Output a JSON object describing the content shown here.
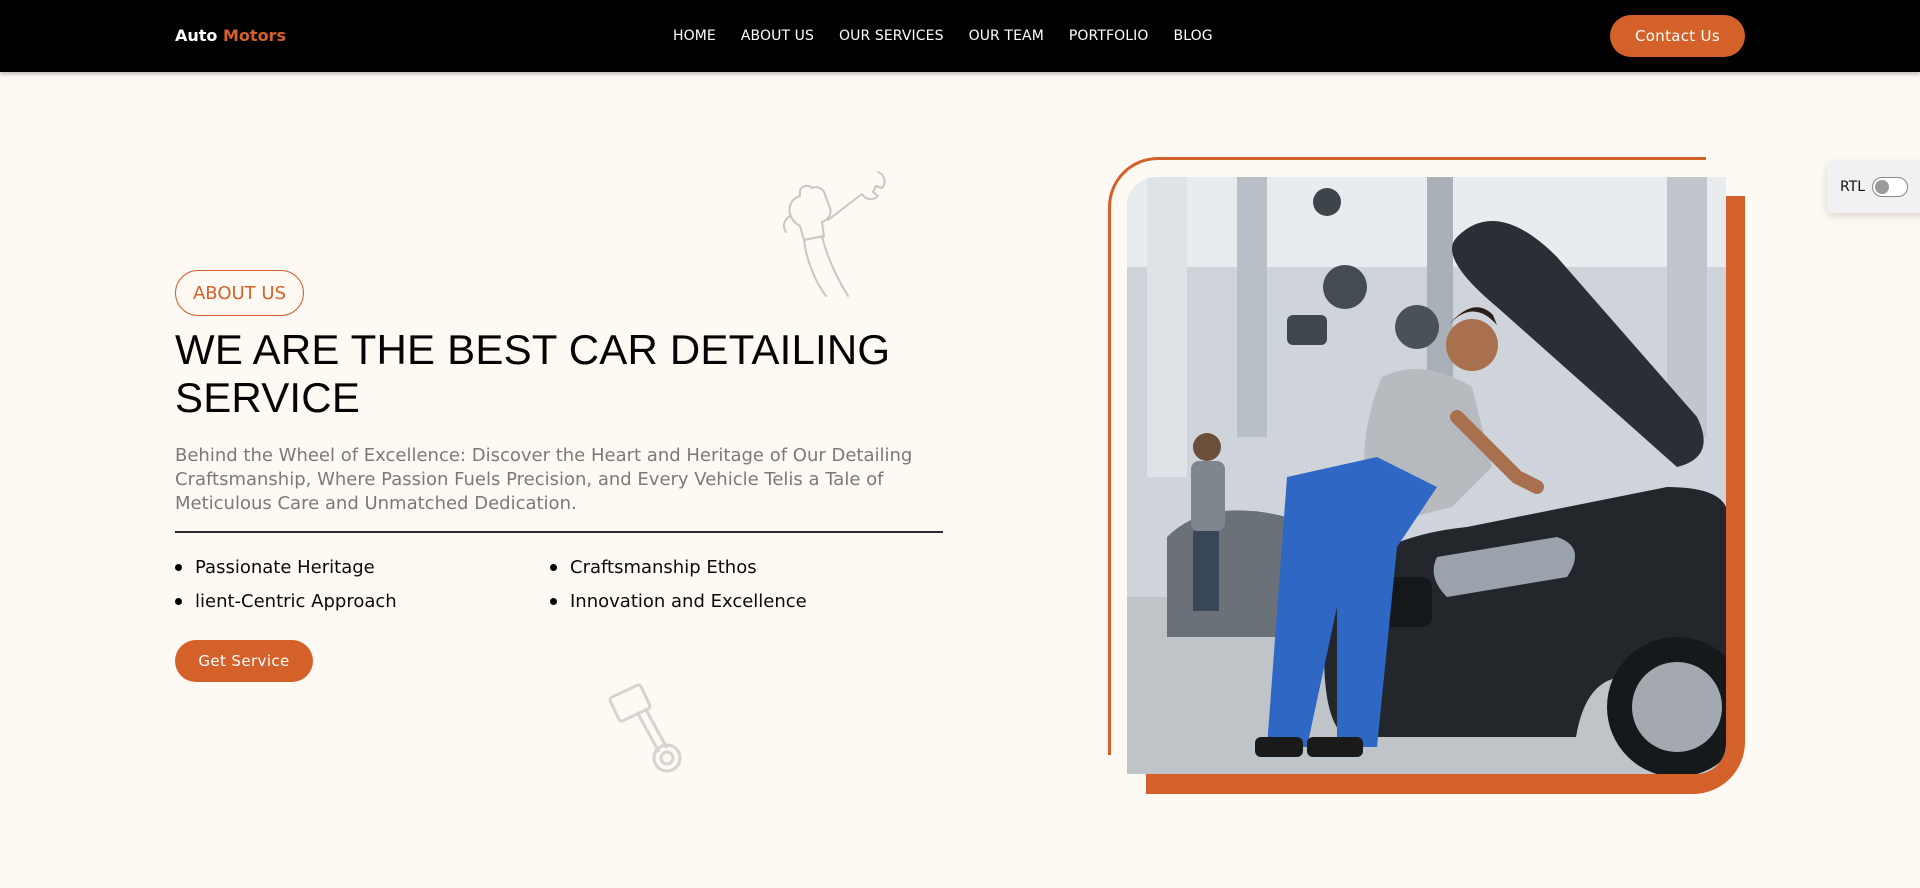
{
  "navbar": {
    "brand_part1": "Auto",
    "brand_part2": "Motors",
    "links": [
      "HOME",
      "ABOUT US",
      "OUR SERVICES",
      "OUR TEAM",
      "PORTFOLIO",
      "BLOG"
    ],
    "contact_label": "Contact Us"
  },
  "about": {
    "tag": "ABOUT US",
    "headline": "WE ARE THE BEST CAR DETAILING SERVICE",
    "description": "Behind the Wheel of Excellence: Discover the Heart and Heritage of Our Detailing Craftsmanship, Where Passion Fuels Precision, and Every Vehicle Telis a Tale of Meticulous Care and Unmatched Dedication.",
    "features": [
      "Passionate Heritage",
      "Craftsmanship Ethos",
      "lient-Centric Approach",
      "Innovation and Excellence"
    ],
    "cta_label": "Get Service"
  },
  "rtl": {
    "label": "RTL",
    "enabled": false
  },
  "colors": {
    "accent": "#d5612a",
    "background": "#fff9f4",
    "navbar": "#000000"
  },
  "icons": {
    "decor_top": "wrench-fist-icon",
    "decor_bottom": "piston-icon"
  }
}
